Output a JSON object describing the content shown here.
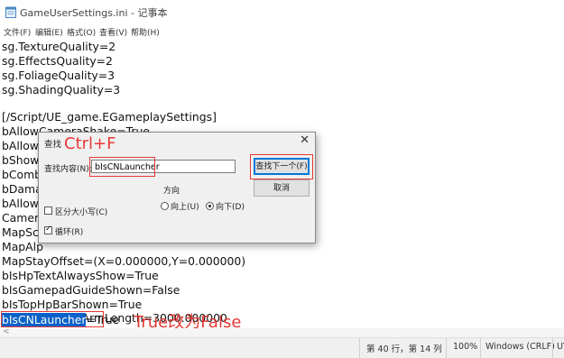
{
  "window": {
    "title": "GameUserSettings.ini - 记事本"
  },
  "menu": [
    "文件(F)",
    "编辑(E)",
    "格式(O)",
    "查看(V)",
    "帮助(H)"
  ],
  "lines": [
    "sg.TextureQuality=2",
    "sg.EffectsQuality=2",
    "sg.FoliageQuality=3",
    "sg.ShadingQuality=3",
    "",
    "[/Script/UE_game.EGameplaySettings]",
    "bAllowCameraShake=True",
    "bAllowF",
    "bShowD",
    "bCombi",
    "bDamag",
    "bAllowA",
    "Camera",
    "MapSca",
    "MapAlp",
    "MapStayOffset=(X=0.000000,Y=0.000000)",
    "bIsHpTextAlwaysShow=True",
    "bIsGamepadGuideShown=False",
    "bIsTopHpBarShown=True",
    "CameraSpringArmLength=3000.000000"
  ],
  "last_line": {
    "selected": "bIsCNLauncher",
    "rest": "=True"
  },
  "annotations": {
    "shortcut": "Ctrl+F",
    "instruction": "True改为False"
  },
  "find_dialog": {
    "title": "查找",
    "close": "✕",
    "find_label": "查找内容(N):",
    "find_value": "bIsCNLauncher",
    "find_next": "查找下一个(F)",
    "cancel": "取消",
    "direction_label": "方向",
    "dir_up": "向上(U)",
    "dir_down": "向下(D)",
    "match_case": "区分大小写(C)",
    "wrap": "循环(R)",
    "match_case_checked": false,
    "wrap_checked": true,
    "direction_selected": "down"
  },
  "status": {
    "position": "第 40 行，第 14 列",
    "zoom": "100%",
    "line_ending": "Windows (CRLF)",
    "encoding": "UT"
  }
}
